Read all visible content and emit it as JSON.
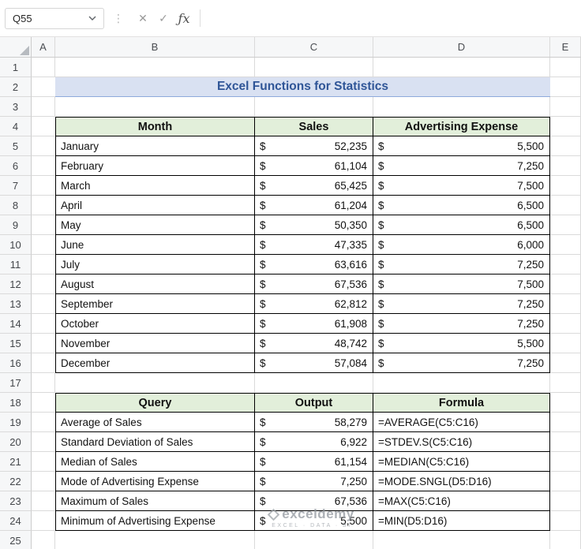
{
  "toolbar": {
    "name_box": "Q55",
    "formula_value": "",
    "cancel_icon": "✕",
    "enter_icon": "✓",
    "fx_label": "ƒx",
    "dots": "⋮"
  },
  "column_headers": [
    "A",
    "B",
    "C",
    "D",
    "E"
  ],
  "row_numbers": [
    "1",
    "2",
    "3",
    "4",
    "5",
    "6",
    "7",
    "8",
    "9",
    "10",
    "11",
    "12",
    "13",
    "14",
    "15",
    "16",
    "17",
    "18",
    "19",
    "20",
    "21",
    "22",
    "23",
    "24",
    "25"
  ],
  "title": "Excel Functions for Statistics",
  "currency": "$",
  "colors": {
    "title_bg": "#d9e1f2",
    "title_text": "#2f5597",
    "table_header_bg": "#e2efda",
    "grid_line": "#dadada",
    "table_border": "#000000"
  },
  "table1": {
    "headers": {
      "month": "Month",
      "sales": "Sales",
      "expense": "Advertising Expense"
    },
    "rows": [
      {
        "month": "January",
        "sales": "52,235",
        "expense": "5,500"
      },
      {
        "month": "February",
        "sales": "61,104",
        "expense": "7,250"
      },
      {
        "month": "March",
        "sales": "65,425",
        "expense": "7,500"
      },
      {
        "month": "April",
        "sales": "61,204",
        "expense": "6,500"
      },
      {
        "month": "May",
        "sales": "50,350",
        "expense": "6,500"
      },
      {
        "month": "June",
        "sales": "47,335",
        "expense": "6,000"
      },
      {
        "month": "July",
        "sales": "63,616",
        "expense": "7,250"
      },
      {
        "month": "August",
        "sales": "67,536",
        "expense": "7,500"
      },
      {
        "month": "September",
        "sales": "62,812",
        "expense": "7,250"
      },
      {
        "month": "October",
        "sales": "61,908",
        "expense": "7,250"
      },
      {
        "month": "November",
        "sales": "48,742",
        "expense": "5,500"
      },
      {
        "month": "December",
        "sales": "57,084",
        "expense": "7,250"
      }
    ]
  },
  "table2": {
    "headers": {
      "query": "Query",
      "output": "Output",
      "formula": "Formula"
    },
    "rows": [
      {
        "query": "Average of Sales",
        "output": "58,279",
        "formula": "=AVERAGE(C5:C16)"
      },
      {
        "query": "Standard Deviation of Sales",
        "output": "6,922",
        "formula": "=STDEV.S(C5:C16)"
      },
      {
        "query": "Median of Sales",
        "output": "61,154",
        "formula": "=MEDIAN(C5:C16)"
      },
      {
        "query": "Mode of Advertising Expense",
        "output": "7,250",
        "formula": "=MODE.SNGL(D5:D16)"
      },
      {
        "query": "Maximum of Sales",
        "output": "67,536",
        "formula": "=MAX(C5:C16)"
      },
      {
        "query": "Minimum of Advertising Expense",
        "output": "5,500",
        "formula": "=MIN(D5:D16)"
      }
    ]
  },
  "watermark": {
    "brand": "exceldemy",
    "tagline": "EXCEL · DATA · BI"
  }
}
